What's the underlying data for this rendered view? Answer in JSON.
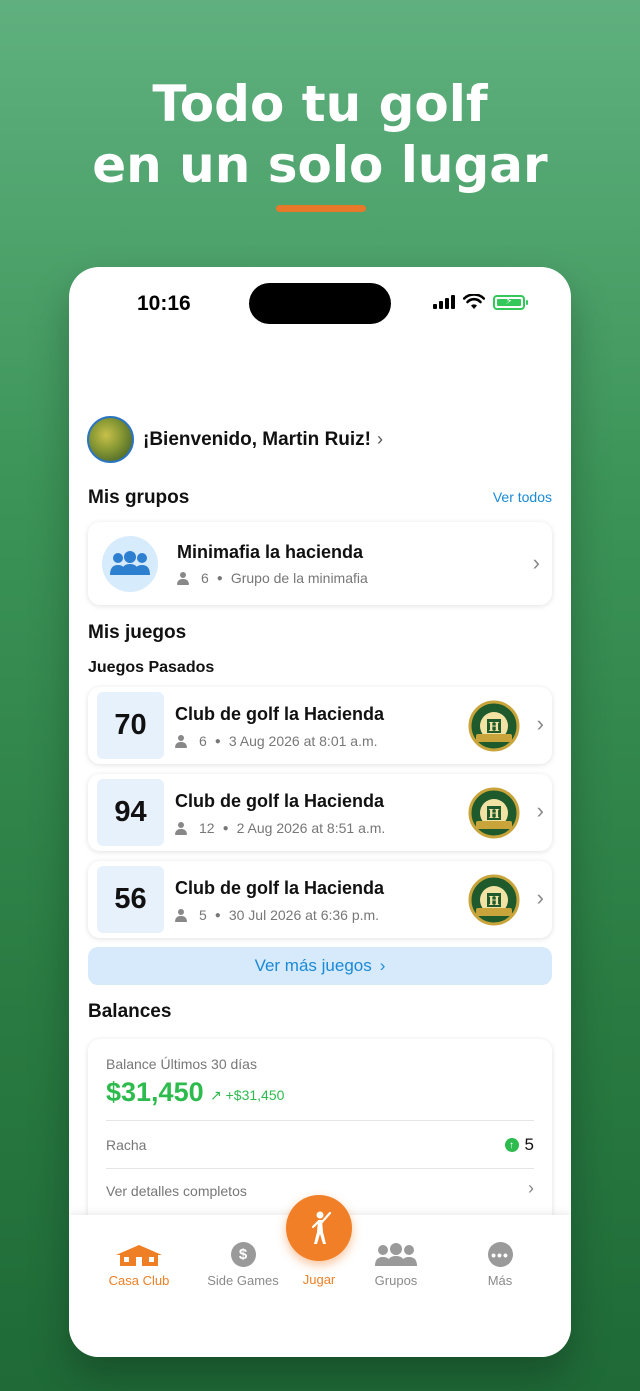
{
  "headline": {
    "line1": "Todo tu golf",
    "line2": "en un solo lugar"
  },
  "status_bar": {
    "time": "10:16"
  },
  "welcome": {
    "text": "¡Bienvenido, Martin Ruiz!"
  },
  "groups_section": {
    "title": "Mis grupos",
    "see_all": "Ver todos",
    "groups": [
      {
        "name": "Minimafia la hacienda",
        "members": "6",
        "description": "Grupo de la minimafia"
      }
    ]
  },
  "games_section": {
    "title": "Mis juegos",
    "subtitle": "Juegos Pasados",
    "games": [
      {
        "score": "70",
        "club": "Club de golf la Hacienda",
        "players": "6",
        "date": "3 Aug 2026 at 8:01 a.m."
      },
      {
        "score": "94",
        "club": "Club de golf la Hacienda",
        "players": "12",
        "date": "2 Aug 2026 at 8:51 a.m."
      },
      {
        "score": "56",
        "club": "Club de golf la Hacienda",
        "players": "5",
        "date": "30 Jul 2026 at 6:36 p.m."
      }
    ],
    "more_button": "Ver más juegos"
  },
  "balances": {
    "title": "Balances",
    "label": "Balance Últimos 30 días",
    "amount": "$31,450",
    "change": "+$31,450",
    "streak_label": "Racha",
    "streak_value": "5",
    "details_label": "Ver detalles completos"
  },
  "tabbar": {
    "tabs": [
      {
        "label": "Casa Club",
        "icon": "house-icon",
        "active": true
      },
      {
        "label": "Side Games",
        "icon": "dollar-icon",
        "active": false
      },
      {
        "label": "Jugar",
        "icon": "golfer-icon",
        "active": false
      },
      {
        "label": "Grupos",
        "icon": "people-icon",
        "active": false
      },
      {
        "label": "Más",
        "icon": "more-icon",
        "active": false
      }
    ]
  },
  "colors": {
    "accent": "#ef7f25",
    "link": "#1a8ad6",
    "positive": "#2dbb4e",
    "background": "#3c9458"
  }
}
